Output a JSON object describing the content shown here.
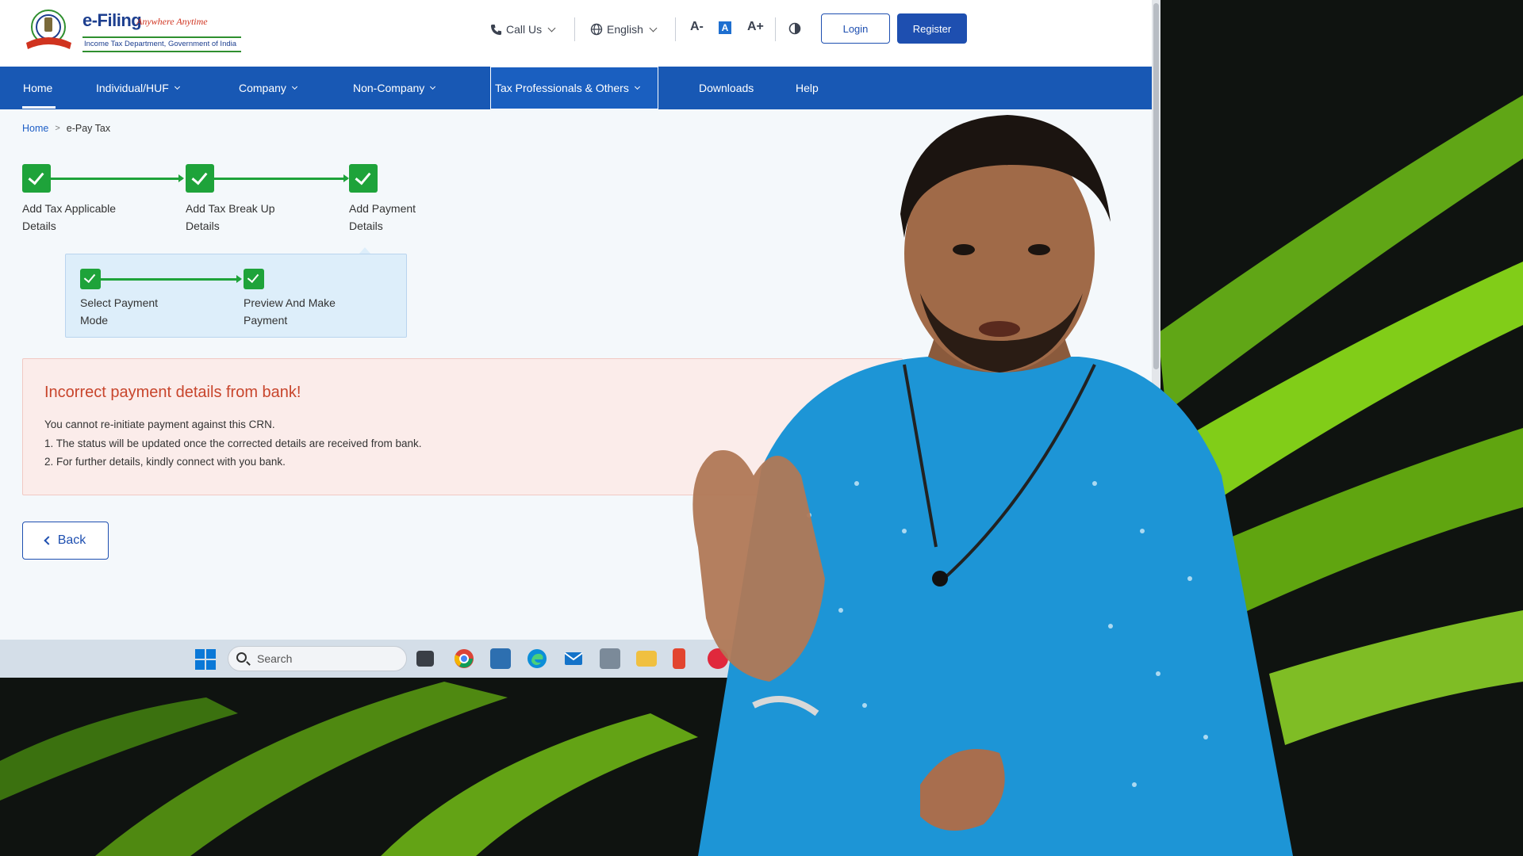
{
  "header": {
    "logo_title": "e-Filing",
    "logo_tagline": "Anywhere Anytime",
    "logo_subtitle": "Income Tax Department, Government of India",
    "call_us": "Call Us",
    "language": "English",
    "font_decrease": "A-",
    "font_reset": "A",
    "font_increase": "A+",
    "login": "Login",
    "register": "Register"
  },
  "nav": {
    "items": [
      "Home",
      "Individual/HUF",
      "Company",
      "Non-Company",
      "Tax Professionals & Others",
      "Downloads",
      "Help"
    ],
    "active": "Tax Professionals & Others"
  },
  "breadcrumb": {
    "home": "Home",
    "separator": ">",
    "current": "e-Pay Tax"
  },
  "stepper": {
    "steps": [
      {
        "line1": "Add Tax Applicable",
        "line2": "Details",
        "status": "complete"
      },
      {
        "line1": "Add Tax Break Up",
        "line2": "Details",
        "status": "complete"
      },
      {
        "line1": "Add Payment",
        "line2": "Details",
        "status": "complete"
      }
    ],
    "substeps": [
      {
        "line1": "Select Payment",
        "line2": "Mode",
        "status": "complete"
      },
      {
        "line1": "Preview And Make",
        "line2": "Payment",
        "status": "complete"
      }
    ]
  },
  "error": {
    "title": "Incorrect payment details from bank!",
    "message": "You cannot re-initiate payment against this CRN.",
    "points": [
      "1. The status will be updated once the corrected details are received from bank.",
      "2. For further details, kindly connect with you bank."
    ]
  },
  "back_button": "Back",
  "taskbar": {
    "search_placeholder": "Search",
    "icons": [
      "windows-start-icon",
      "task-view-icon",
      "chrome-icon",
      "photos-icon",
      "edge-icon",
      "mail-icon",
      "settings-icon",
      "file-explorer-icon",
      "office-icon",
      "app-icon"
    ]
  },
  "colors": {
    "nav_blue": "#1858b4",
    "step_green": "#1ea33a",
    "error_red": "#c8452c",
    "error_bg": "#fbecea",
    "presenter_shirt": "#1d95d6"
  }
}
